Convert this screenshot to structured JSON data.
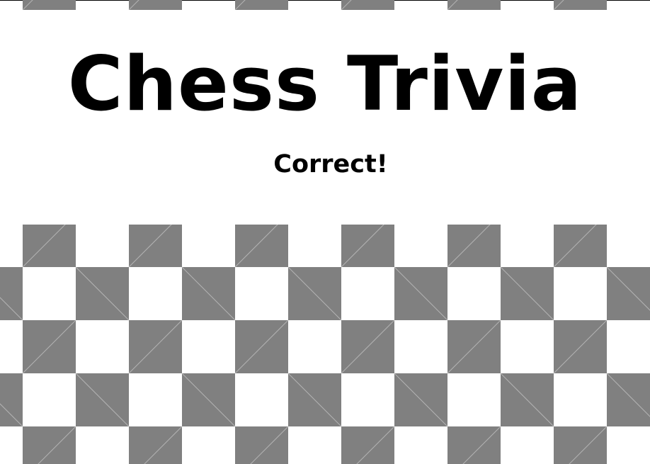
{
  "game": {
    "title": "Chess Trivia",
    "status": "Correct!"
  },
  "board": {
    "dark_square_color": "#808080",
    "light_square_color": "#ffffff",
    "diagonal_line_color": "#b3b3b3"
  }
}
